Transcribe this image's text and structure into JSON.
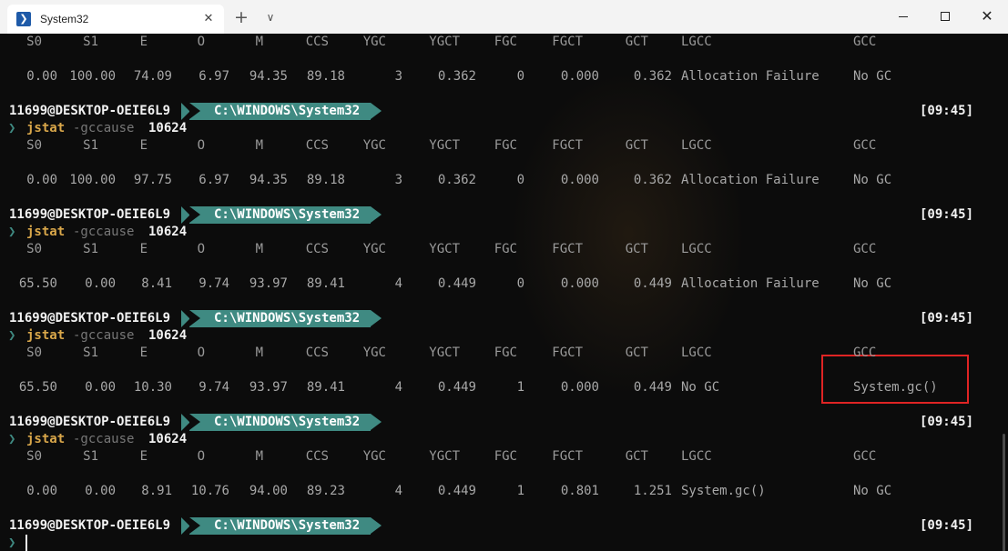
{
  "window": {
    "tab_title": "System32",
    "tab_icon": "powershell-icon",
    "close_tab_glyph": "✕",
    "new_tab_glyph": "+",
    "dropdown_glyph": "∨",
    "close_window_glyph": "✕"
  },
  "columns": [
    "S0",
    "S1",
    "E",
    "O",
    "M",
    "CCS",
    "YGC",
    "YGCT",
    "FGC",
    "FGCT",
    "GCT",
    "LGCC",
    "GCC"
  ],
  "prompt": {
    "user": "11699@DESKTOP-OEIE6L9",
    "path": "C:\\WINDOWS\\System32",
    "time": "[09:45]",
    "arrow": "❯",
    "command": "jstat",
    "option": "-gccause",
    "pid": "10624"
  },
  "rows": [
    {
      "S0": "0.00",
      "S1": "100.00",
      "E": "74.09",
      "O": "6.97",
      "M": "94.35",
      "CCS": "89.18",
      "YGC": "3",
      "YGCT": "0.362",
      "FGC": "0",
      "FGCT": "0.000",
      "GCT": "0.362",
      "LGCC": "Allocation Failure",
      "GCC": "No GC"
    },
    {
      "S0": "0.00",
      "S1": "100.00",
      "E": "97.75",
      "O": "6.97",
      "M": "94.35",
      "CCS": "89.18",
      "YGC": "3",
      "YGCT": "0.362",
      "FGC": "0",
      "FGCT": "0.000",
      "GCT": "0.362",
      "LGCC": "Allocation Failure",
      "GCC": "No GC"
    },
    {
      "S0": "65.50",
      "S1": "0.00",
      "E": "8.41",
      "O": "9.74",
      "M": "93.97",
      "CCS": "89.41",
      "YGC": "4",
      "YGCT": "0.449",
      "FGC": "0",
      "FGCT": "0.000",
      "GCT": "0.449",
      "LGCC": "Allocation Failure",
      "GCC": "No GC"
    },
    {
      "S0": "65.50",
      "S1": "0.00",
      "E": "10.30",
      "O": "9.74",
      "M": "93.97",
      "CCS": "89.41",
      "YGC": "4",
      "YGCT": "0.449",
      "FGC": "1",
      "FGCT": "0.000",
      "GCT": "0.449",
      "LGCC": "No GC",
      "GCC": "System.gc()"
    },
    {
      "S0": "0.00",
      "S1": "0.00",
      "E": "8.91",
      "O": "10.76",
      "M": "94.00",
      "CCS": "89.23",
      "YGC": "4",
      "YGCT": "0.449",
      "FGC": "1",
      "FGCT": "0.801",
      "GCT": "1.251",
      "LGCC": "System.gc()",
      "GCC": "No GC"
    }
  ],
  "colors": {
    "terminal_bg": "#0c0c0c",
    "prompt_path_bg": "#3f8a82",
    "command": "#d9a74a",
    "highlight_box": "#e02424"
  }
}
